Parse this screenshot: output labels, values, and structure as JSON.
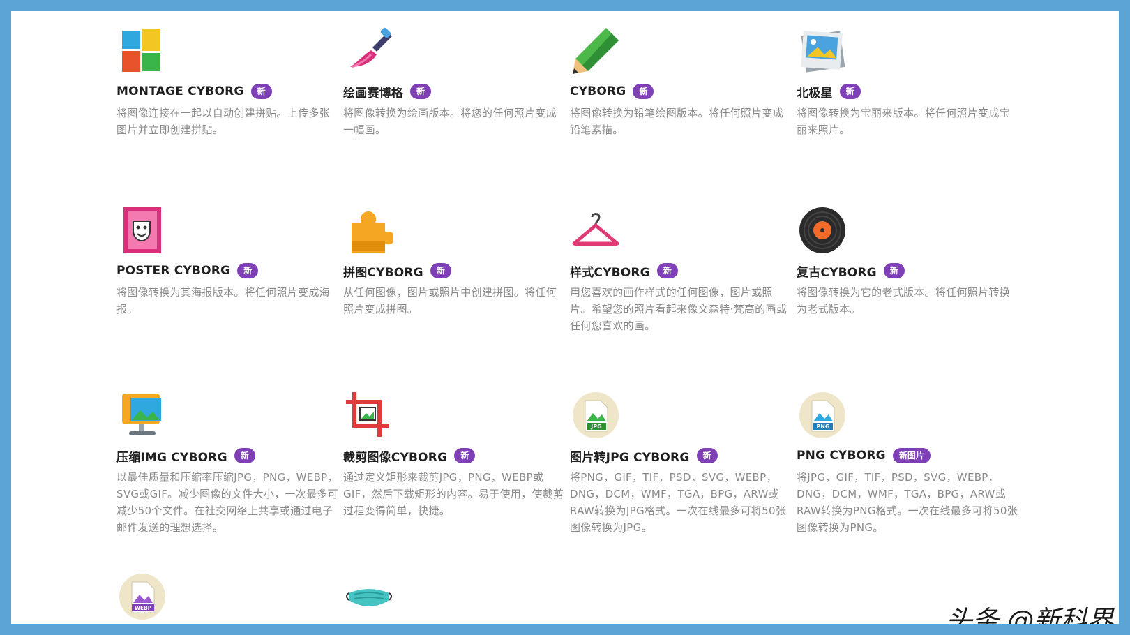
{
  "tools": [
    {
      "title": "MONTAGE CYBORG",
      "badge": "新",
      "icon": "montage-grid-icon",
      "desc": "将图像连接在一起以自动创建拼贴。上传多张图片并立即创建拼贴。"
    },
    {
      "title": "绘画赛博格",
      "badge": "新",
      "icon": "paintbrush-icon",
      "desc": "将图像转换为绘画版本。将您的任何照片变成一幅画。"
    },
    {
      "title": "CYBORG",
      "badge": "新",
      "icon": "pencil-icon",
      "desc": "将图像转换为铅笔绘图版本。将任何照片变成铅笔素描。"
    },
    {
      "title": "北极星",
      "badge": "新",
      "icon": "polaroid-photo-icon",
      "desc": "将图像转换为宝丽来版本。将任何照片变成宝丽来照片。"
    },
    {
      "title": "POSTER CYBORG",
      "badge": "新",
      "icon": "theater-mask-poster-icon",
      "desc": "将图像转换为其海报版本。将任何照片变成海报。"
    },
    {
      "title": "拼图CYBORG",
      "badge": "新",
      "icon": "puzzle-piece-icon",
      "desc": "从任何图像，图片或照片中创建拼图。将任何照片变成拼图。"
    },
    {
      "title": "样式CYBORG",
      "badge": "新",
      "icon": "hanger-icon",
      "desc": "用您喜欢的画作样式的任何图像，图片或照片。希望您的照片看起来像文森特·梵高的画或任何您喜欢的画。"
    },
    {
      "title": "复古CYBORG",
      "badge": "新",
      "icon": "vinyl-record-icon",
      "desc": "将图像转换为它的老式版本。将任何照片转换为老式版本。"
    },
    {
      "title": "压缩IMG CYBORG",
      "badge": "新",
      "icon": "compress-image-icon",
      "desc": "以最佳质量和压缩率压缩JPG，PNG，WEBP，SVG或GIF。减少图像的文件大小，一次最多可减少50个文件。在社交网络上共享或通过电子邮件发送的理想选择。"
    },
    {
      "title": "裁剪图像CYBORG",
      "badge": "新",
      "icon": "crop-icon",
      "desc": "通过定义矩形来裁剪JPG，PNG，WEBP或GIF，然后下载矩形的内容。易于使用，使裁剪过程变得简单，快捷。"
    },
    {
      "title": "图片转JPG CYBORG",
      "badge": "新",
      "icon": "jpg-file-icon",
      "desc": "将PNG，GIF，TIF，PSD，SVG，WEBP，DNG，DCM，WMF，TGA，BPG，ARW或RAW转换为JPG格式。一次在线最多可将50张图像转换为JPG。"
    },
    {
      "title": "PNG CYBORG",
      "badge": "新图片",
      "icon": "png-file-icon",
      "desc": "将JPG，GIF，TIF，PSD，SVG，WEBP，DNG，DCM，WMF，TGA，BPG，ARW或RAW转换为PNG格式。一次在线最多可将50张图像转换为PNG。"
    }
  ],
  "partial_icons": [
    "webp-file-icon",
    "face-mask-icon"
  ],
  "icon_labels": {
    "jpg": "JPG",
    "png": "PNG",
    "webp": "WEBP"
  },
  "watermark": "头条 @新科界",
  "colors": {
    "frame": "#5aa5d6",
    "badge": "#7f3fb6",
    "desc": "#8a8a8a",
    "title": "#1f1f1f"
  }
}
